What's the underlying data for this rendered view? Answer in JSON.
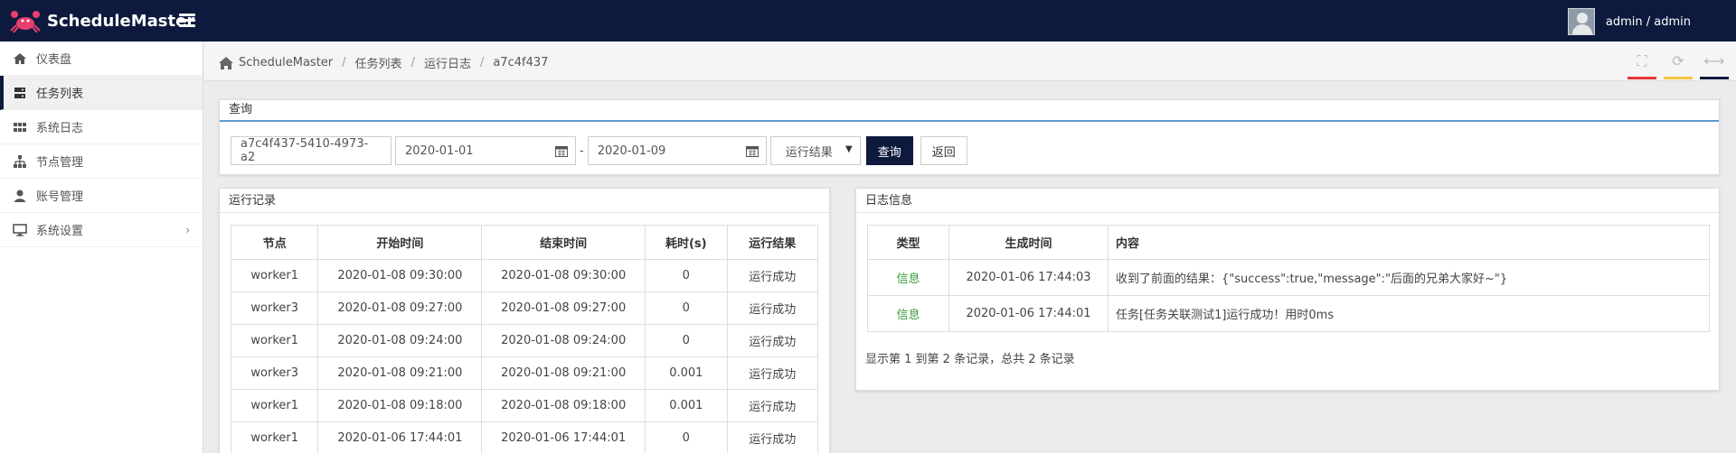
{
  "app": {
    "brand": "ScheduleMaster",
    "user": "admin / admin"
  },
  "sidebar": {
    "items": [
      {
        "label": "仪表盘",
        "icon": "home-icon"
      },
      {
        "label": "任务列表",
        "icon": "server-icon"
      },
      {
        "label": "系统日志",
        "icon": "grid-icon"
      },
      {
        "label": "节点管理",
        "icon": "sitemap-icon"
      },
      {
        "label": "账号管理",
        "icon": "user-icon"
      },
      {
        "label": "系统设置",
        "icon": "desktop-icon"
      }
    ],
    "active": "任务列表"
  },
  "breadcrumb": {
    "items": [
      "ScheduleMaster",
      "任务列表",
      "运行日志",
      "a7c4f437"
    ]
  },
  "toolbar": {
    "colors": [
      "#e53935",
      "#f5c542",
      "#0e1a3d"
    ]
  },
  "query": {
    "title": "查询",
    "task_id": "a7c4f437-5410-4973-a2",
    "start_date": "2020-01-01",
    "dash": "-",
    "end_date": "2020-01-09",
    "result_select": "运行结果",
    "search_label": "查询",
    "back_label": "返回"
  },
  "runs": {
    "title": "运行记录",
    "columns": [
      "节点",
      "开始时间",
      "结束时间",
      "耗时(s)",
      "运行结果"
    ],
    "rows": [
      [
        "worker1",
        "2020-01-08 09:30:00",
        "2020-01-08 09:30:00",
        "0",
        "运行成功"
      ],
      [
        "worker3",
        "2020-01-08 09:27:00",
        "2020-01-08 09:27:00",
        "0",
        "运行成功"
      ],
      [
        "worker1",
        "2020-01-08 09:24:00",
        "2020-01-08 09:24:00",
        "0",
        "运行成功"
      ],
      [
        "worker3",
        "2020-01-08 09:21:00",
        "2020-01-08 09:21:00",
        "0.001",
        "运行成功"
      ],
      [
        "worker1",
        "2020-01-08 09:18:00",
        "2020-01-08 09:18:00",
        "0.001",
        "运行成功"
      ],
      [
        "worker1",
        "2020-01-06 17:44:01",
        "2020-01-06 17:44:01",
        "0",
        "运行成功"
      ]
    ]
  },
  "logs": {
    "title": "日志信息",
    "columns": [
      "类型",
      "生成时间",
      "内容"
    ],
    "rows": [
      [
        "信息",
        "2020-01-06 17:44:03",
        "收到了前面的结果：{\"success\":true,\"message\":\"后面的兄弟大家好~\"}"
      ],
      [
        "信息",
        "2020-01-06 17:44:01",
        "任务[任务关联测试1]运行成功！用时0ms"
      ]
    ],
    "footer": "显示第 1 到第 2 条记录，总共 2 条记录"
  }
}
